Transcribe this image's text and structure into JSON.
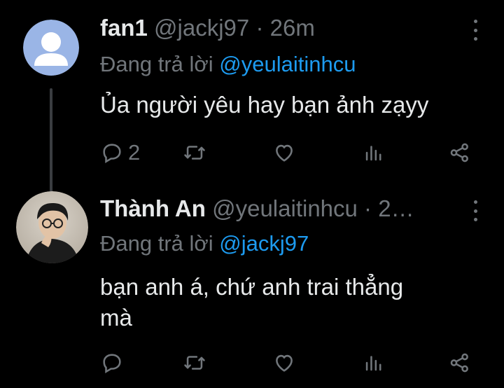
{
  "tweets": [
    {
      "display_name": "fan1",
      "handle": "@jackj97",
      "separator": "·",
      "time": "26m",
      "reply_prefix": "Đang trả lời",
      "reply_mention": "@yeulaitinhcu",
      "body": "Ủa người yêu hay bạn ảnh zạyy",
      "reply_count": "2",
      "avatar": "default-user-avatar"
    },
    {
      "display_name": "Thành An",
      "handle": "@yeulaitinhcu",
      "separator": "·",
      "time": "2…",
      "reply_prefix": "Đang trả lời",
      "reply_mention": "@jackj97",
      "body_line1": "bạn anh á, chứ anh trai thẳng",
      "body_line2": "mà",
      "reply_count": "",
      "avatar": "photo-avatar"
    }
  ],
  "icons": {
    "reply": "reply-icon",
    "retweet": "retweet-icon",
    "like": "heart-icon",
    "views": "views-icon",
    "share": "share-icon",
    "more": "more-icon"
  },
  "colors": {
    "background": "#000000",
    "text": "#e7e9ea",
    "muted": "#71767b",
    "mention": "#1d9bf0",
    "thread_line": "#3a3d41"
  }
}
